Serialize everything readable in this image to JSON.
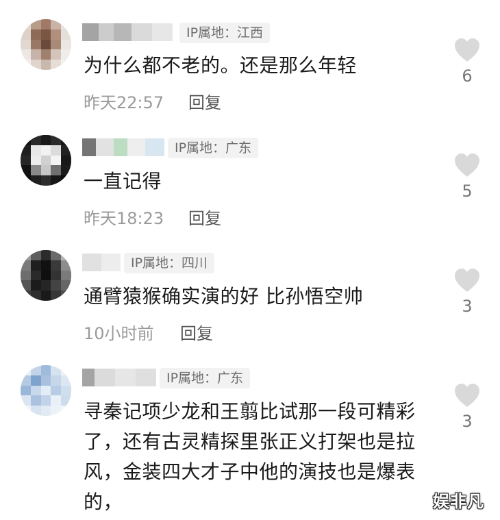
{
  "comments": [
    {
      "ip": "IP属地：江西",
      "text": "为什么都不老的。还是那么年轻",
      "time": "昨天22:57",
      "reply": "回复",
      "likes": "6"
    },
    {
      "ip": "IP属地：广东",
      "text": "一直记得",
      "time": "昨天18:23",
      "reply": "回复",
      "likes": "5"
    },
    {
      "ip": "IP属地：四川",
      "text": "通臂猿猴确实演的好  比孙悟空帅",
      "time": "10小时前",
      "reply": "回复",
      "likes": "3"
    },
    {
      "ip": "IP属地：广东",
      "text": "寻秦记项少龙和王翦比试那一段可精彩了，还有古灵精探里张正义打架也是拉风，金装四大才子中他的演技也是爆表的，",
      "likes": "3"
    }
  ],
  "watermark": "娱非凡",
  "colors": {
    "heart": "#d9d9d9",
    "tag_bg": "#f2f2f2",
    "meta": "#9a9a9a"
  },
  "icons": {
    "like": "heart-icon"
  }
}
